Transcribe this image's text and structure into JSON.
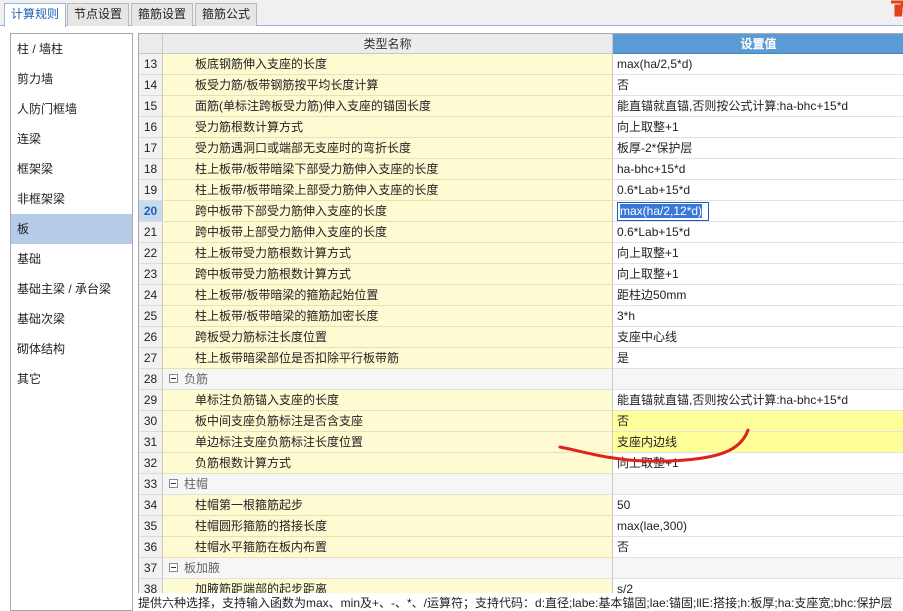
{
  "tabs": [
    "计算规则",
    "节点设置",
    "箍筋设置",
    "箍筋公式"
  ],
  "sidebar": [
    "柱 / 墙柱",
    "剪力墙",
    "人防门框墙",
    "连梁",
    "框架梁",
    "非框架梁",
    "板",
    "基础",
    "基础主梁 / 承台梁",
    "基础次梁",
    "砌体结构",
    "其它"
  ],
  "grid": {
    "header_name": "类型名称",
    "header_value": "设置值",
    "rows": [
      {
        "num": "13",
        "name": "板底钢筋伸入支座的长度",
        "value": "max(ha/2,5*d)"
      },
      {
        "num": "14",
        "name": "板受力筋/板带钢筋按平均长度计算",
        "value": "否"
      },
      {
        "num": "15",
        "name": "面筋(单标注跨板受力筋)伸入支座的锚固长度",
        "value": "能直锚就直锚,否则按公式计算:ha-bhc+15*d"
      },
      {
        "num": "16",
        "name": "受力筋根数计算方式",
        "value": "向上取整+1"
      },
      {
        "num": "17",
        "name": "受力筋遇洞口或端部无支座时的弯折长度",
        "value": "板厚-2*保护层"
      },
      {
        "num": "18",
        "name": "柱上板带/板带暗梁下部受力筋伸入支座的长度",
        "value": "ha-bhc+15*d"
      },
      {
        "num": "19",
        "name": "柱上板带/板带暗梁上部受力筋伸入支座的长度",
        "value": "0.6*Lab+15*d"
      },
      {
        "num": "20",
        "name": "跨中板带下部受力筋伸入支座的长度",
        "value": "max(ha/2,12*d)"
      },
      {
        "num": "21",
        "name": "跨中板带上部受力筋伸入支座的长度",
        "value": "0.6*Lab+15*d"
      },
      {
        "num": "22",
        "name": "柱上板带受力筋根数计算方式",
        "value": "向上取整+1"
      },
      {
        "num": "23",
        "name": "跨中板带受力筋根数计算方式",
        "value": "向上取整+1"
      },
      {
        "num": "24",
        "name": "柱上板带/板带暗梁的箍筋起始位置",
        "value": "距柱边50mm"
      },
      {
        "num": "25",
        "name": "柱上板带/板带暗梁的箍筋加密长度",
        "value": "3*h"
      },
      {
        "num": "26",
        "name": "跨板受力筋标注长度位置",
        "value": "支座中心线"
      },
      {
        "num": "27",
        "name": "柱上板带暗梁部位是否扣除平行板带筋",
        "value": "是"
      },
      {
        "num": "28",
        "name": "负筋",
        "value": ""
      },
      {
        "num": "29",
        "name": "单标注负筋锚入支座的长度",
        "value": "能直锚就直锚,否则按公式计算:ha-bhc+15*d"
      },
      {
        "num": "30",
        "name": "板中间支座负筋标注是否含支座",
        "value": "否"
      },
      {
        "num": "31",
        "name": "单边标注支座负筋标注长度位置",
        "value": "支座内边线"
      },
      {
        "num": "32",
        "name": "负筋根数计算方式",
        "value": "向上取整+1"
      },
      {
        "num": "33",
        "name": "柱帽",
        "value": ""
      },
      {
        "num": "34",
        "name": "柱帽第一根箍筋起步",
        "value": "50"
      },
      {
        "num": "35",
        "name": "柱帽圆形箍筋的搭接长度",
        "value": "max(lae,300)"
      },
      {
        "num": "36",
        "name": "柱帽水平箍筋在板内布置",
        "value": "否"
      },
      {
        "num": "37",
        "name": "板加腋",
        "value": ""
      },
      {
        "num": "38",
        "name": "加腋筋距端部的起步距离",
        "value": "s/2"
      }
    ]
  },
  "status_text": "提供六种选择，支持输入函数为max、min及+、-、*、/运算符；支持代码：d:直径;labe:基本锚固;lae:锚固;llE:搭接;h:板厚;ha:支座宽;bhc:保护层",
  "colors": {
    "accent": "#5b9bd5",
    "row_name_bg": "#fefbd2",
    "highlight": "#ffff99",
    "annotation": "#e0221c",
    "selected": "#b6cbe8"
  },
  "icons": [
    "collapse-icon",
    "app-logo-icon"
  ]
}
